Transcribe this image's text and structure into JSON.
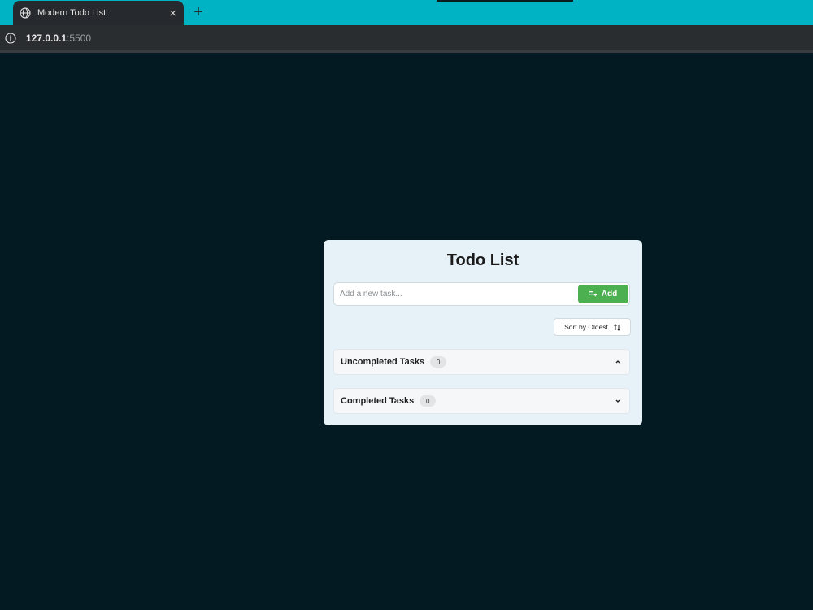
{
  "browser": {
    "tab_title": "Modern Todo List",
    "close_symbol": "×",
    "new_tab_symbol": "+",
    "url_host": "127.0.0.1",
    "url_port": ":5500",
    "icons": {
      "tab": "globe-icon",
      "info": "info-icon"
    }
  },
  "todo": {
    "title": "Todo List",
    "input_placeholder": "Add a new task...",
    "input_value": "",
    "add_label": "Add",
    "sort_label": "Sort by Oldest",
    "sections": [
      {
        "label": "Uncompleted Tasks",
        "count": "0",
        "expanded": true,
        "chevron": "chevron-up-icon"
      },
      {
        "label": "Completed Tasks",
        "count": "0",
        "expanded": false,
        "chevron": "chevron-down-icon"
      }
    ]
  },
  "colors": {
    "page_background": "#031a23",
    "tabbar": "#00b3c4",
    "card": "#e7f1f8",
    "add_button": "#4caf50"
  }
}
